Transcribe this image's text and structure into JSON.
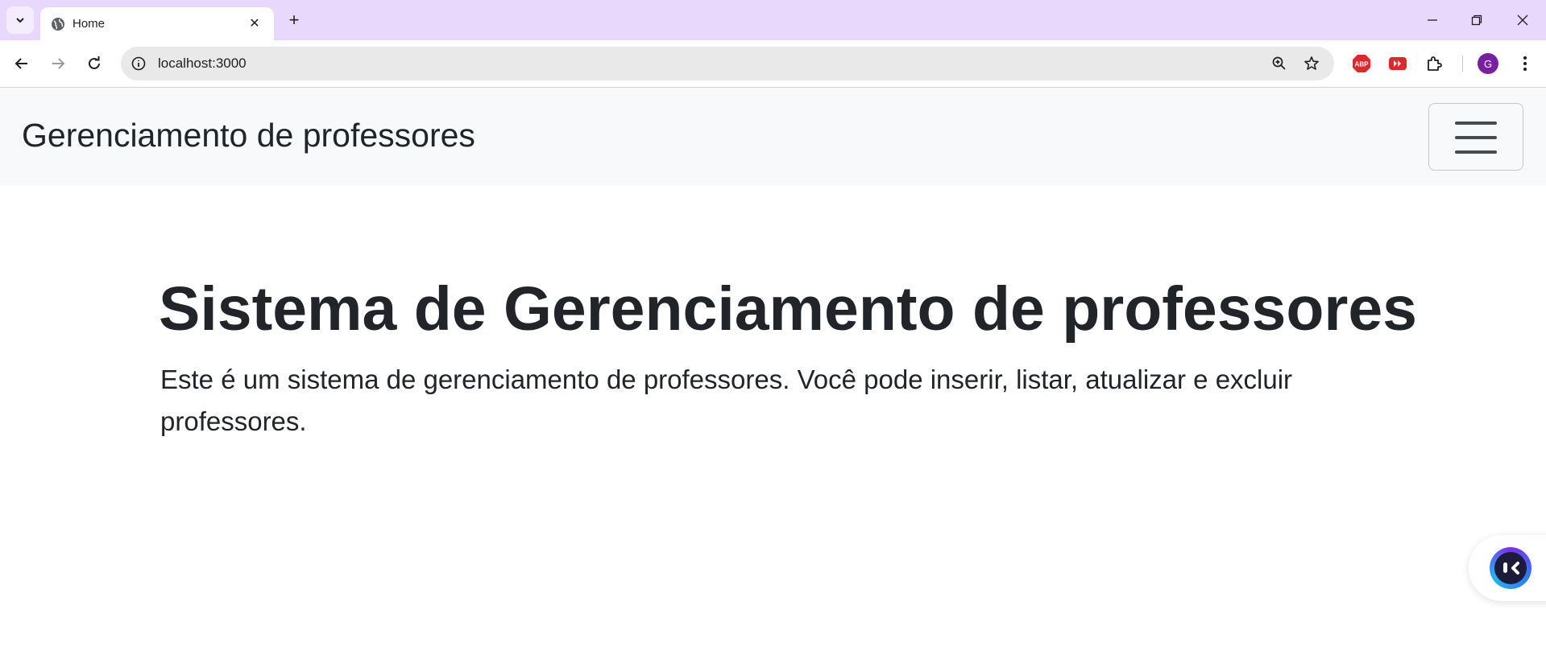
{
  "browser": {
    "tab_title": "Home",
    "url": "localhost:3000",
    "profile_initial": "G",
    "icons": {
      "tab_search": "chevron-down-icon",
      "favicon": "globe-icon",
      "tab_close": "close-icon",
      "new_tab": "plus-icon",
      "minimize": "minimize-icon",
      "restore": "restore-icon",
      "close_window": "close-icon",
      "back": "arrow-left-icon",
      "forward": "arrow-right-icon",
      "reload": "reload-icon",
      "site_info": "info-icon",
      "zoom": "zoom-icon",
      "bookmark": "star-icon",
      "adblock": "adblock-icon",
      "youtube_ext": "youtube-icon",
      "extensions": "puzzle-icon",
      "menu": "kebab-menu-icon"
    },
    "colors": {
      "tabstrip": "#e8d8fc",
      "profile": "#7b1fa2",
      "adblock": "#e0272b"
    }
  },
  "page": {
    "navbar": {
      "brand": "Gerenciamento de professores",
      "toggler_icon": "hamburger-menu-icon"
    },
    "hero": {
      "title": "Sistema de Gerenciamento de professores",
      "lead": "Este é um sistema de gerenciamento de professores. Você pode inserir, listar, atualizar e excluir professores."
    },
    "assistant_icon": "assistant-bot-icon"
  }
}
